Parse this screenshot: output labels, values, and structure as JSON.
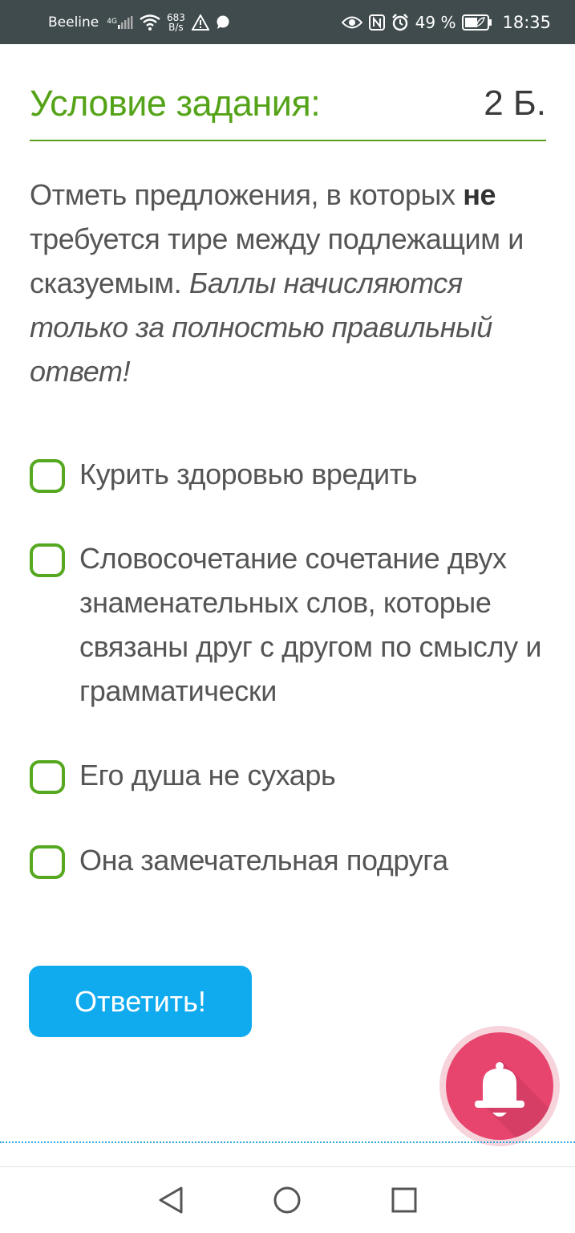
{
  "status_bar": {
    "carrier": "Beeline",
    "network_type": "4G",
    "data_speed_value": "683",
    "data_speed_unit": "B/s",
    "battery_percent": "49 %",
    "time": "18:35"
  },
  "task": {
    "title": "Условие задания:",
    "points": "2 Б.",
    "question_part1": "Отметь предложения, в которых ",
    "question_negation": "не",
    "question_part2": " требуется тире между подлежащим и сказуемым. ",
    "question_note": "Баллы начисляются только за полностью правильный ответ!"
  },
  "options": [
    {
      "label": "Курить здоровью вредить",
      "checked": false
    },
    {
      "label": "Словосочетание сочетание двух знаменательных слов, которые связаны друг с другом по смыслу и грамматически",
      "checked": false
    },
    {
      "label": "Его душа не сухарь",
      "checked": false
    },
    {
      "label": "Она замечательная подруга",
      "checked": false
    }
  ],
  "submit_label": "Ответить!",
  "colors": {
    "accent_green": "#54a318",
    "button_blue": "#10aaee",
    "bell_pink": "#e8456e",
    "status_bar_bg": "#3f4b4d"
  },
  "icons": {
    "fab": "bell-icon",
    "nav_back": "back-triangle-icon",
    "nav_home": "home-circle-icon",
    "nav_recents": "recents-square-icon"
  }
}
